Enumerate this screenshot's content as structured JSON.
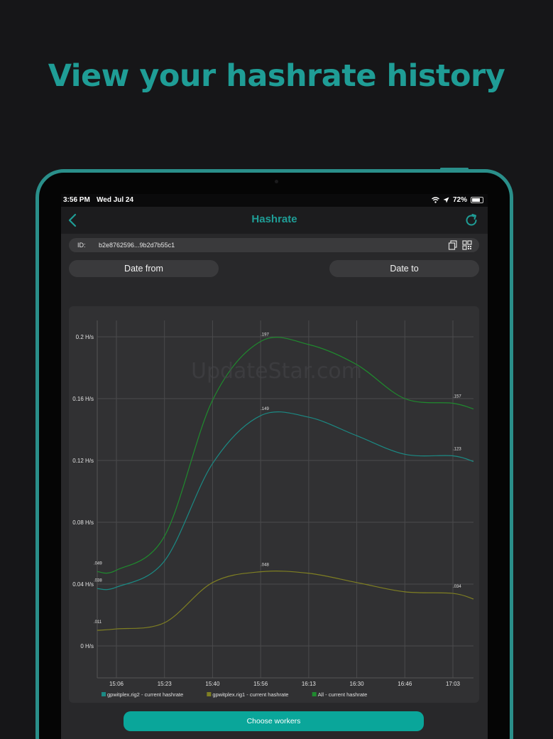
{
  "headline": "View your hashrate history",
  "status": {
    "time": "3:56 PM",
    "date": "Wed Jul 24",
    "battery": "72%"
  },
  "nav": {
    "title": "Hashrate"
  },
  "worker": {
    "id_label": "ID:",
    "id_value": "b2e8762596...9b2d7b55c1"
  },
  "filters": {
    "date_from": "Date from",
    "date_to": "Date to"
  },
  "actions": {
    "choose_workers": "Choose workers"
  },
  "watermark": "UpdateStar.com",
  "colors": {
    "accent": "#1f9d96",
    "button": "#0aa69a",
    "rig2": "#1b8a84",
    "rig1": "#7f7f22",
    "all": "#1f8a2e"
  },
  "chart_data": {
    "type": "line",
    "title": "",
    "xlabel": "",
    "ylabel": "",
    "x": [
      "15:06",
      "15:23",
      "15:40",
      "15:56",
      "16:13",
      "16:30",
      "16:46",
      "17:03"
    ],
    "y_ticks": [
      "0 H/s",
      "0.04 H/s",
      "0.08 H/s",
      "0.12 H/s",
      "0.16 H/s",
      "0.2 H/s"
    ],
    "ylim": [
      0,
      0.2
    ],
    "grid": true,
    "legend": "bottom",
    "series": [
      {
        "name": "gpwitplex.rig2 - current hashrate",
        "color": "#1b8a84",
        "values": [
          0.038,
          0.055,
          0.118,
          0.149,
          0.148,
          0.136,
          0.124,
          0.123
        ],
        "point_labels": [
          ".038",
          "",
          "",
          ".149",
          "",
          "",
          "",
          ".123"
        ]
      },
      {
        "name": "gpwitplex.rig1 - current hashrate",
        "color": "#7f7f22",
        "values": [
          0.011,
          0.015,
          0.041,
          0.048,
          0.047,
          0.041,
          0.035,
          0.034
        ],
        "point_labels": [
          ".011",
          "",
          "",
          ".048",
          "",
          "",
          "",
          ".034"
        ]
      },
      {
        "name": "All - current hashrate",
        "color": "#1f8a2e",
        "values": [
          0.049,
          0.071,
          0.159,
          0.197,
          0.195,
          0.182,
          0.16,
          0.157
        ],
        "point_labels": [
          ".049",
          "",
          "",
          ".197",
          "",
          "",
          "",
          ".157"
        ]
      }
    ]
  }
}
